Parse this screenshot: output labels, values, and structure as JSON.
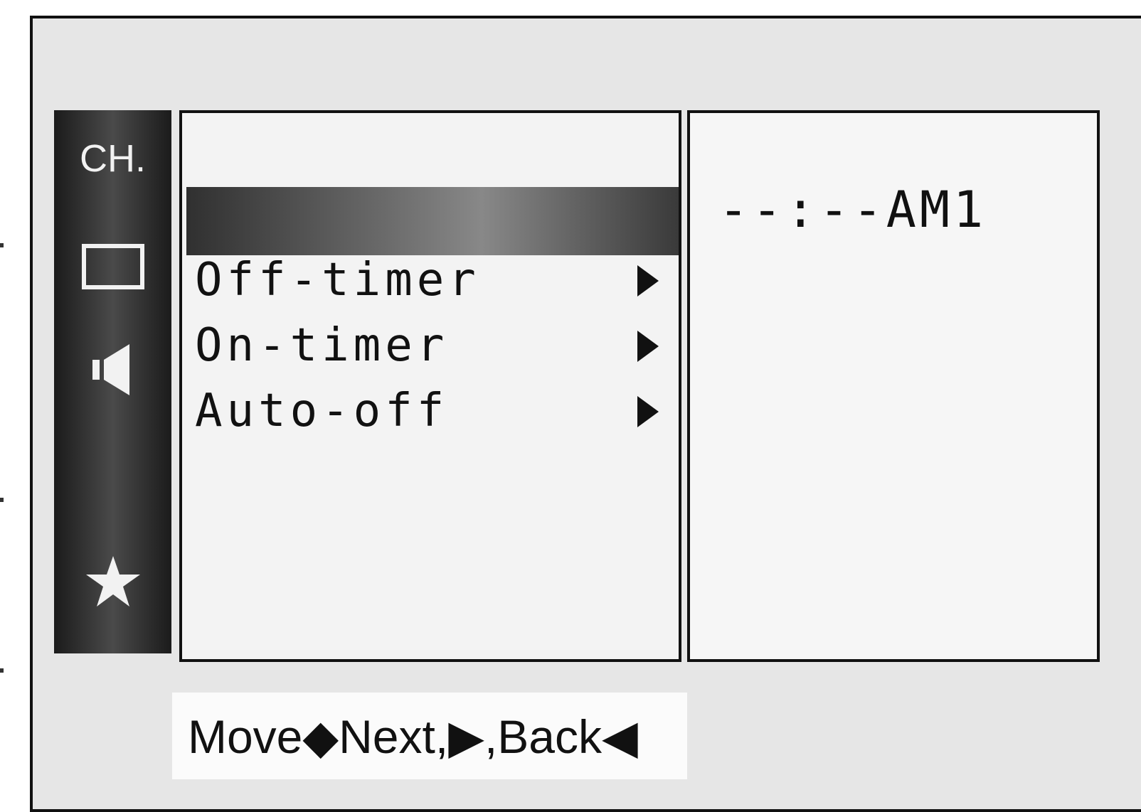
{
  "sidebar": {
    "items": [
      {
        "label": "CH.",
        "icon": "channel-label"
      },
      {
        "icon": "screen-icon"
      },
      {
        "icon": "speaker-icon"
      },
      {
        "icon": "star-icon"
      }
    ]
  },
  "menu": {
    "items": [
      {
        "label": "Off-timer",
        "arrow": "right-arrow-icon"
      },
      {
        "label": "On-timer",
        "arrow": "right-arrow-icon"
      },
      {
        "label": "Auto-off",
        "arrow": "right-arrow-icon"
      }
    ]
  },
  "value_panel": {
    "time": "--:--AM1"
  },
  "help": {
    "text": "Move◆Next,▶,Back◀"
  },
  "colors": {
    "background": "#e6e6e6",
    "sidebar": "#2e2e2e",
    "panel": "#f3f3f3",
    "text": "#111111"
  }
}
